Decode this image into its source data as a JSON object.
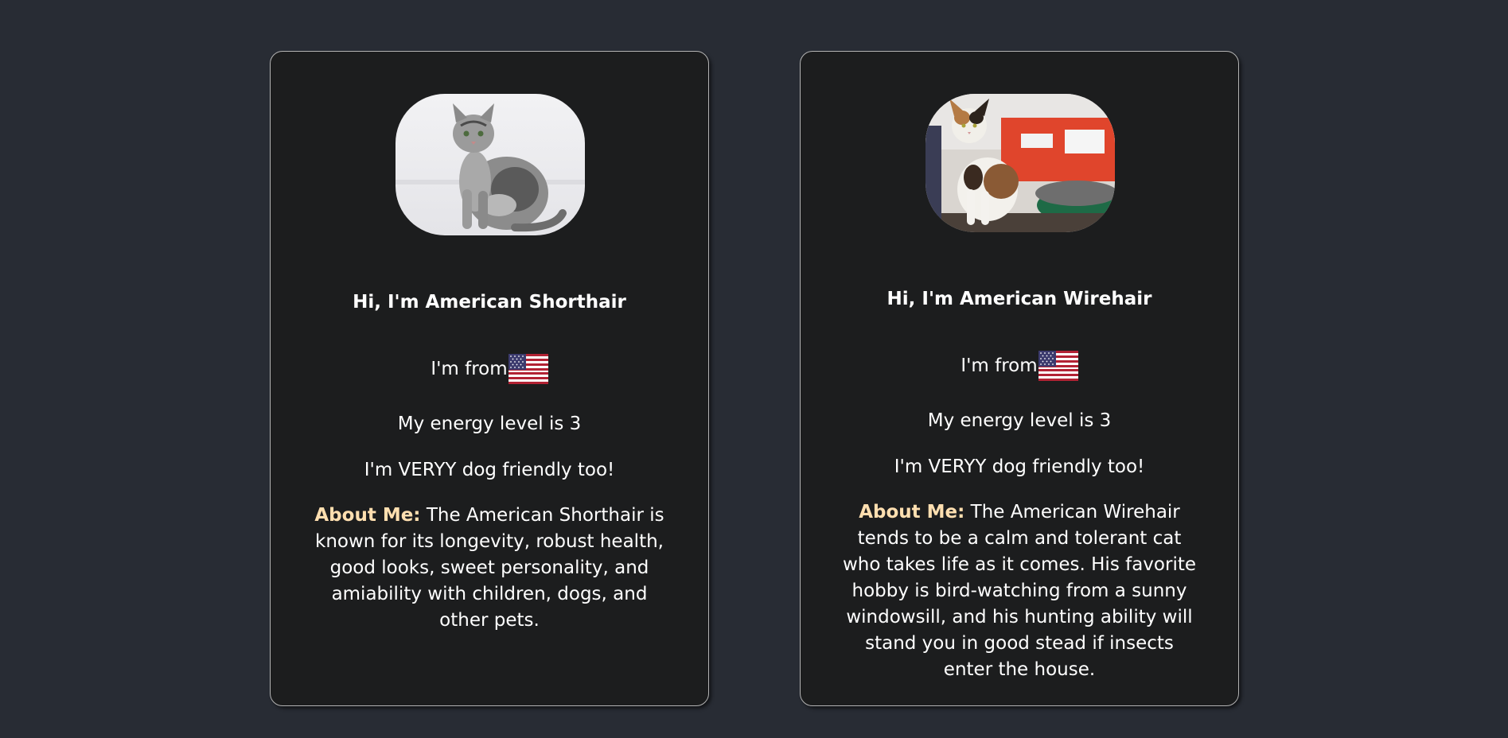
{
  "cards": [
    {
      "greeting": "Hi, I'm American Shorthair",
      "origin_label": "I'm from",
      "origin_flag_icon": "us-flag-icon",
      "energy": "My energy level is 3",
      "friendly": "I'm VERYY dog friendly too!",
      "about_label": "About Me:",
      "about_text": "The American Shorthair is known for its longevity, robust health, good looks, sweet personality, and amiability with children, dogs, and other pets."
    },
    {
      "greeting": "Hi, I'm American Wirehair",
      "origin_label": "I'm from",
      "origin_flag_icon": "us-flag-icon",
      "energy": "My energy level is 3",
      "friendly": "I'm VERYY dog friendly too!",
      "about_label": "About Me:",
      "about_text": "The American Wirehair tends to be a calm and tolerant cat who takes life as it comes. His favorite hobby is bird-watching from a sunny windowsill, and his hunting ability will stand you in good stead if insects enter the house."
    }
  ],
  "colors": {
    "background": "#282c34",
    "card": "#1c1d1e",
    "accent": "#ffdfb0"
  }
}
